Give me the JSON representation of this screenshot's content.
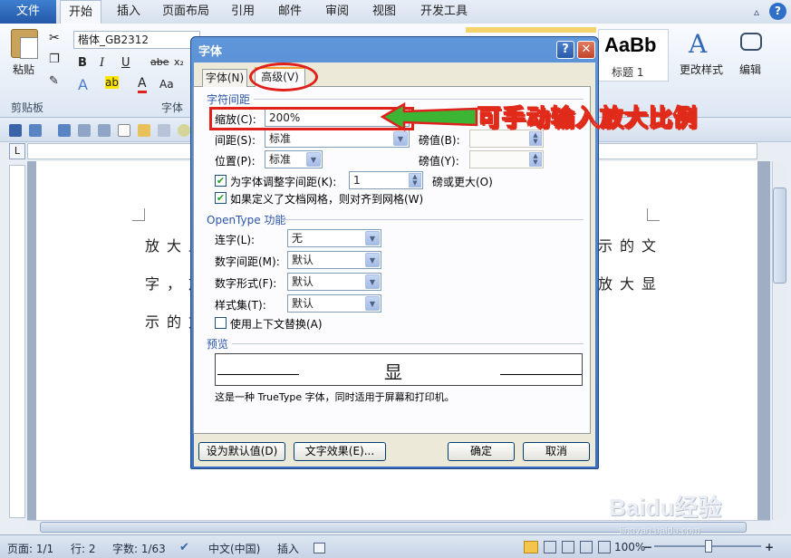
{
  "ribbon": {
    "file_tab": "文件",
    "tabs": [
      "开始",
      "插入",
      "页面布局",
      "引用",
      "邮件",
      "审阅",
      "视图",
      "开发工具"
    ],
    "paste_label": "粘贴",
    "clipboard_group": "剪贴板",
    "font_group": "字体",
    "font_name": "楷体_GB2312",
    "style_sample": "AaBb",
    "style_name": "标题 1",
    "change_style": "更改样式",
    "edit": "编辑"
  },
  "document": {
    "lines": [
      "放大显",
      "字，放",
      "示的文"
    ],
    "right_lines": [
      "示的文",
      "放大显"
    ]
  },
  "dialog": {
    "title": "字体",
    "tabs": [
      "字体(N)",
      "高级(V)"
    ],
    "spacing_section": "字符间距",
    "scale_label": "缩放(C):",
    "scale_value": "200%",
    "spacing_label": "间距(S):",
    "spacing_value": "标准",
    "spacing_by_label": "磅值(B):",
    "position_label": "位置(P):",
    "position_value": "标准",
    "position_by_label": "磅值(Y):",
    "kerning_label": "为字体调整字间距(K):",
    "kerning_value": "1",
    "kerning_suffix": "磅或更大(O)",
    "grid_label": "如果定义了文档网格，则对齐到网格(W)",
    "opentype_section": "OpenType 功能",
    "ligatures_label": "连字(L):",
    "ligatures_value": "无",
    "num_spacing_label": "数字间距(M):",
    "num_spacing_value": "默认",
    "num_forms_label": "数字形式(F):",
    "num_forms_value": "默认",
    "stylistic_label": "样式集(T):",
    "stylistic_value": "默认",
    "contextual_label": "使用上下文替换(A)",
    "preview_section": "预览",
    "preview_char": "显",
    "preview_note": "这是一种 TrueType 字体，同时适用于屏幕和打印机。",
    "btn_default": "设为默认值(D)",
    "btn_effects": "文字效果(E)...",
    "btn_ok": "确定",
    "btn_cancel": "取消"
  },
  "annotation": {
    "text": "可手动输入放大比例",
    "color": "#e0201a"
  },
  "status": {
    "page": "页面: 1/1",
    "line": "行: 2",
    "words": "字数: 1/63",
    "lang": "中文(中国)",
    "insert": "插入",
    "zoom": "100%"
  },
  "watermark": {
    "main": "Baidu经验",
    "sub": "jingyan.baidu.com"
  }
}
